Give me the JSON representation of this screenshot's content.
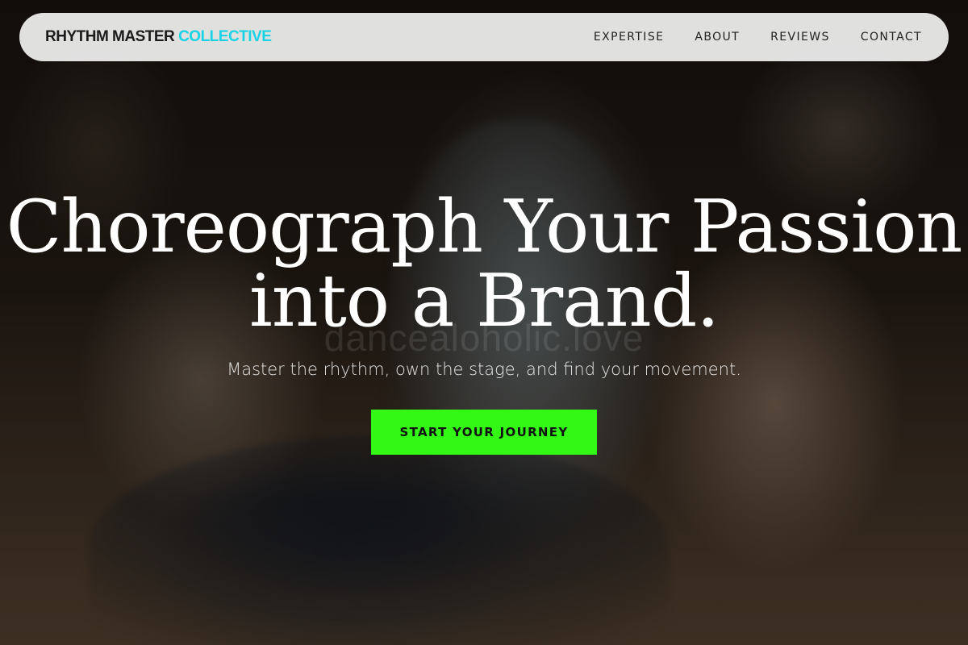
{
  "nav": {
    "brand_primary": "RHYTHM MASTER",
    "brand_accent": "COLLECTIVE",
    "links": [
      {
        "label": "EXPERTISE"
      },
      {
        "label": "ABOUT"
      },
      {
        "label": "REVIEWS"
      },
      {
        "label": "CONTACT"
      }
    ]
  },
  "hero": {
    "headline_line1": "Choreograph Your Passion",
    "headline_line2": "into a Brand.",
    "watermark": "dancealoholic.love",
    "subtitle": "Master the rhythm, own the stage, and find your movement.",
    "cta_label": "START YOUR JOURNEY",
    "background_image": "dimly lit dance studio with dancers stretching on a wooden floor"
  },
  "colors": {
    "brand_accent": "#18d3e6",
    "cta_background": "#33f714",
    "nav_background": "#f0f0f0",
    "headline_text": "#ffffff"
  }
}
